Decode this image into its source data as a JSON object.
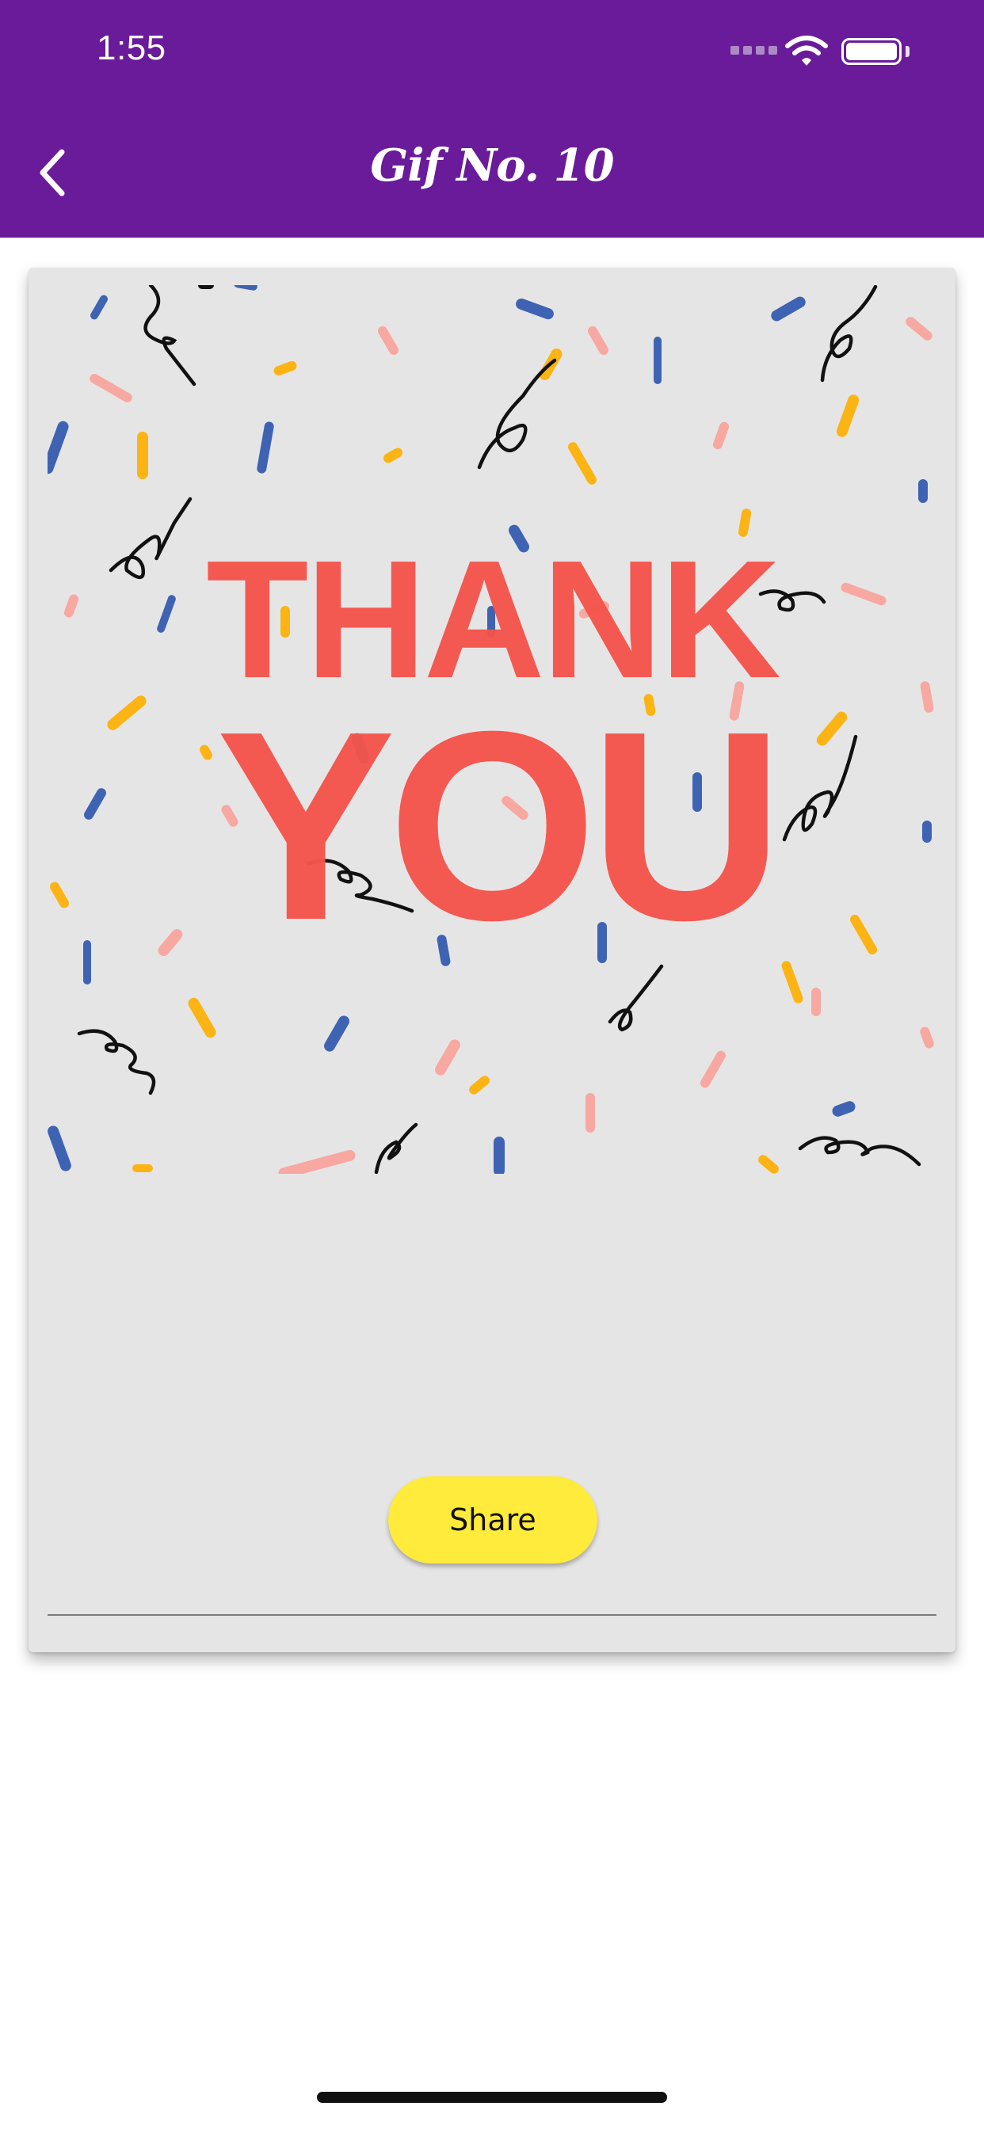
{
  "status_bar": {
    "time": "1:55",
    "icons": [
      "signal-icon",
      "wifi-icon",
      "battery-icon"
    ]
  },
  "header": {
    "title": "Gif No. 10",
    "back_icon": "chevron-left-icon",
    "background_color": "#6a1b9a"
  },
  "card": {
    "gif_text_line1": "THANK",
    "gif_text_line2": "YOU",
    "gif_text_color": "#f4544a",
    "confetti_colors": [
      "#3f63b3",
      "#f7a8a0",
      "#fbb413",
      "#111111"
    ],
    "share_label": "Share",
    "share_color": "#ffeb3b"
  }
}
